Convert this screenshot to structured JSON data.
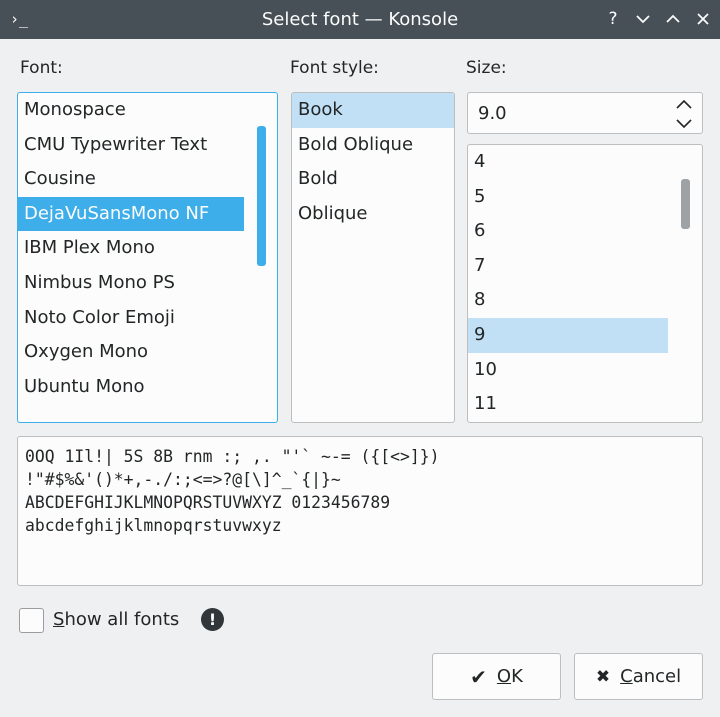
{
  "window": {
    "title": "Select font — Konsole",
    "app_icon": "konsole-prompt-icon",
    "controls": {
      "help": "?",
      "minimize": "⌄",
      "maximize": "⌃",
      "close": "✕"
    }
  },
  "font": {
    "label": "Font:",
    "items": [
      "Monospace",
      "CMU Typewriter Text",
      "Cousine",
      "DejaVuSansMono NF",
      "IBM Plex Mono",
      "Nimbus Mono PS",
      "Noto Color Emoji",
      "Oxygen Mono",
      "Ubuntu Mono"
    ],
    "selected": "DejaVuSansMono NF"
  },
  "style": {
    "label": "Font style:",
    "items": [
      "Book",
      "Bold Oblique",
      "Bold",
      "Oblique"
    ],
    "selected": "Book"
  },
  "size": {
    "label": "Size:",
    "value": "9.0",
    "items": [
      "4",
      "5",
      "6",
      "7",
      "8",
      "9",
      "10",
      "11"
    ],
    "selected": "9"
  },
  "preview": {
    "line1": "0OQ 1Il!| 5S 8B rnm :; ,. \"'` ~-= ({[<>]})",
    "line2": "!\"#$%&'()*+,-./:;<=>?@[\\]^_`{|}~",
    "line3": "ABCDEFGHIJKLMNOPQRSTUVWXYZ 0123456789",
    "line4": "abcdefghijklmnopqrstuvwxyz"
  },
  "show_all_fonts": {
    "label_first": "S",
    "label_rest": "how all fonts",
    "checked": false,
    "info_icon": "!"
  },
  "buttons": {
    "ok": {
      "glyph": "✔",
      "first": "O",
      "rest": "K"
    },
    "cancel": {
      "glyph": "✖",
      "first": "C",
      "rest": "ancel"
    }
  },
  "colors": {
    "accent": "#3daee9",
    "selection_inactive": "#c2e0f5",
    "titlebar": "#475057",
    "window_bg": "#eff0f1"
  }
}
